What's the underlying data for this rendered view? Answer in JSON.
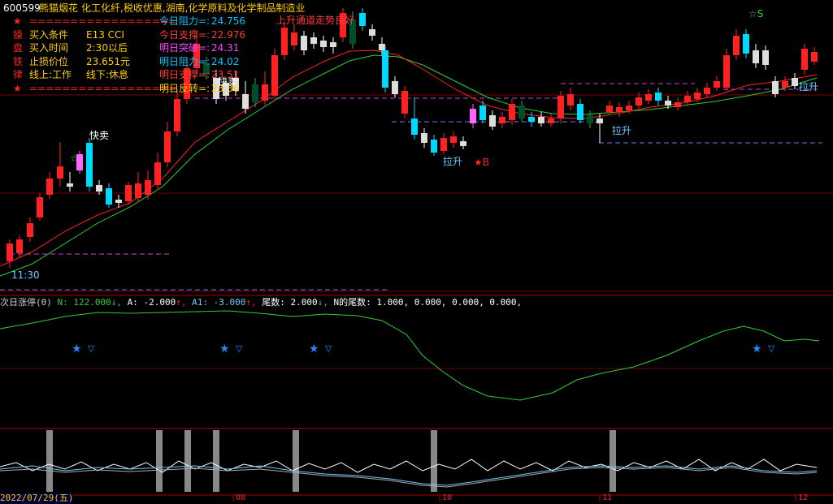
{
  "header": {
    "stock_code": "600599",
    "stock_name": "熊猫烟花",
    "concepts": "化工化纤,税收优惠,湖南,化学原料及化学制品制造业"
  },
  "info_panel": {
    "rows": [
      {
        "marker": "★",
        "label": "==================",
        "value": ""
      },
      {
        "marker": "操",
        "label": "买入条件",
        "value": "E13 CCI"
      },
      {
        "marker": "盘",
        "label": "买入时间",
        "value": "2:30以后"
      },
      {
        "marker": "铁",
        "label": "止损价位",
        "value": "23.651元"
      },
      {
        "marker": "律",
        "label": "线上:工作",
        "value": "线下:休息"
      },
      {
        "marker": "★",
        "label": "==================",
        "value": ""
      }
    ]
  },
  "price_levels": [
    {
      "label": "今日阻力=:",
      "value": "24.756",
      "color": "#00c8ff"
    },
    {
      "label": "今日支撑=:",
      "value": "22.976",
      "color": "#ff3b3b"
    },
    {
      "label": "明日突破=:",
      "value": "24.31",
      "color": "#ff44ff"
    },
    {
      "label": "明日阻力=:",
      "value": "24.02",
      "color": "#00c8ff"
    },
    {
      "label": "明日支撑=:",
      "value": "23.51",
      "color": "#ff3b3b"
    },
    {
      "label": "明日反转=:",
      "value": "23.36",
      "color": "#ffcc00"
    }
  ],
  "annotations": {
    "trend_note": "上升通道走势良好",
    "sell_1": "快卖",
    "sell_2": "快卖",
    "rise_1": "拉升",
    "rise_2": "拉升",
    "rise_3": "拉升",
    "star_b": "★B",
    "star_s": "☆S",
    "star_left": "☆",
    "time_label": "11:30"
  },
  "indicator": {
    "name": "次日涨停(0)",
    "n_label": "N:",
    "n_value": "122.000",
    "a_label": "A:",
    "a_value": "-2.000",
    "a1_label": "A1:",
    "a1_value": "-3.000",
    "tail_label": "尾数:",
    "tail_value": "2.000",
    "n_tail_label": "N的尾数:",
    "n_tail_values": "1.000, 0.000, 0.000, 0.000,"
  },
  "axis": {
    "date_label": "2022/07/29(五)",
    "month_marks": [
      "08",
      "10",
      "11",
      "12"
    ]
  },
  "colors": {
    "up": "#ff2222",
    "down_cyan": "#00d8ff",
    "neutral": "#ffffff",
    "dark_green": "#004d2a",
    "ma_red": "#ff2222",
    "ma_green": "#33cc33",
    "dash_magenta": "#cc44cc",
    "dash_blue": "#7777ee",
    "grid_red": "#7a0000"
  }
}
